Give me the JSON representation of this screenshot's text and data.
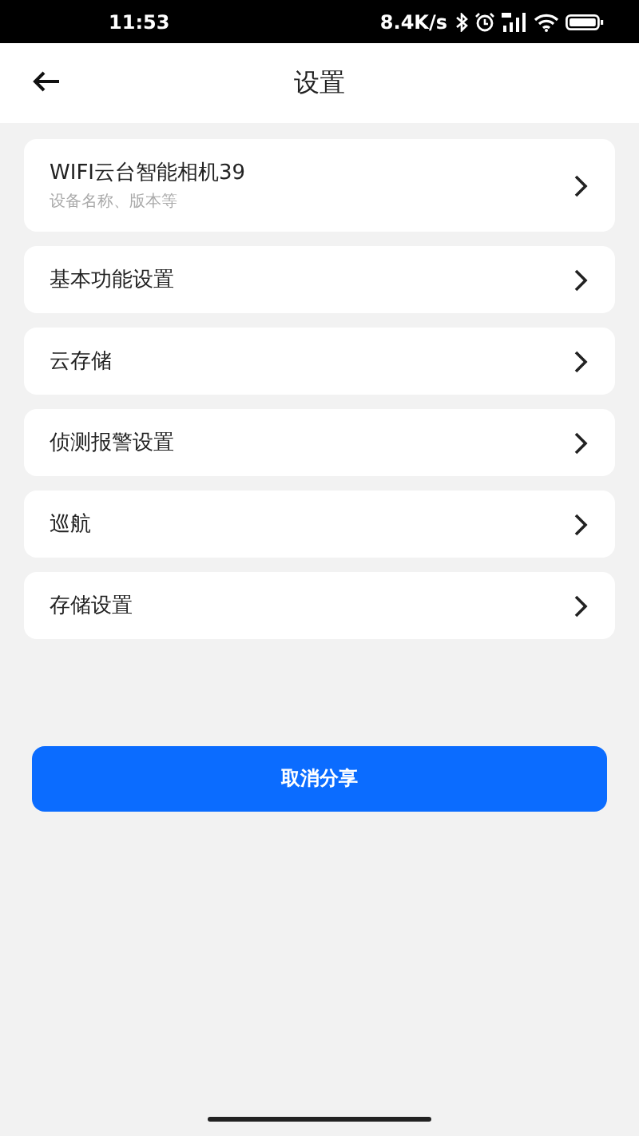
{
  "status_bar": {
    "time": "11:53",
    "speed": "8.4K/s"
  },
  "header": {
    "title": "设置"
  },
  "items": [
    {
      "kind": "device",
      "title": "WIFI云台智能相机39",
      "subtitle": "设备名称、版本等"
    },
    {
      "kind": "plain",
      "title": "基本功能设置"
    },
    {
      "kind": "plain",
      "title": "云存储"
    },
    {
      "kind": "plain",
      "title": "侦测报警设置"
    },
    {
      "kind": "plain",
      "title": "巡航"
    },
    {
      "kind": "plain",
      "title": "存储设置"
    }
  ],
  "action_button": {
    "label": "取消分享"
  }
}
